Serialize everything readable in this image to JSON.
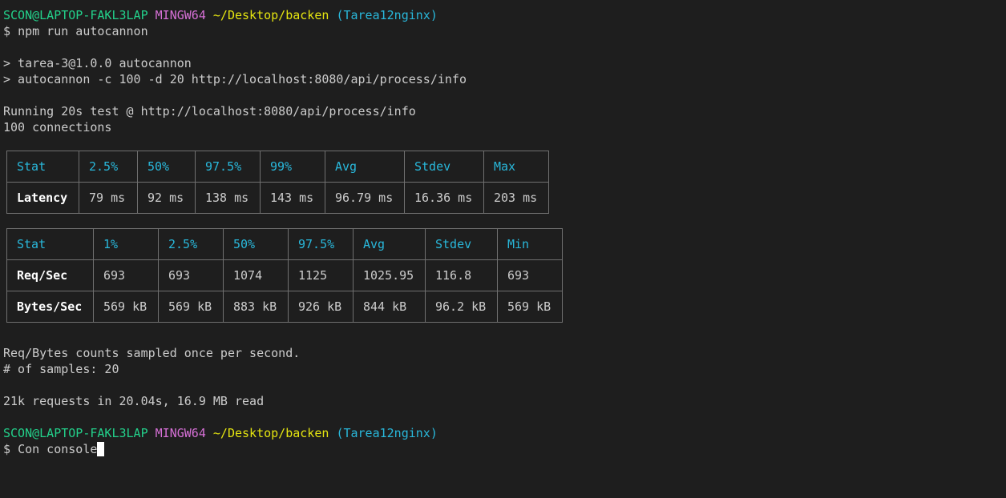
{
  "prompt": {
    "user_host": "SCON@LAPTOP-FAKL3LAP",
    "shell": "MINGW64",
    "path": "~/Desktop/backen",
    "branch": "(Tarea12nginx)",
    "symbol": "$"
  },
  "command": "npm run autocannon",
  "npm_output": [
    "> tarea-3@1.0.0 autocannon",
    "> autocannon -c 100 -d 20 http://localhost:8080/api/process/info"
  ],
  "run_info": [
    "Running 20s test @ http://localhost:8080/api/process/info",
    "100 connections"
  ],
  "latency_table": {
    "headers": [
      "Stat",
      "2.5%",
      "50%",
      "97.5%",
      "99%",
      "Avg",
      "Stdev",
      "Max"
    ],
    "rows": [
      [
        "Latency",
        "79 ms",
        "92 ms",
        "138 ms",
        "143 ms",
        "96.79 ms",
        "16.36 ms",
        "203 ms"
      ]
    ]
  },
  "throughput_table": {
    "headers": [
      "Stat",
      "1%",
      "2.5%",
      "50%",
      "97.5%",
      "Avg",
      "Stdev",
      "Min"
    ],
    "rows": [
      [
        "Req/Sec",
        "693",
        "693",
        "1074",
        "1125",
        "1025.95",
        "116.8",
        "693"
      ],
      [
        "Bytes/Sec",
        "569 kB",
        "569 kB",
        "883 kB",
        "926 kB",
        "844 kB",
        "96.2 kB",
        "569 kB"
      ]
    ]
  },
  "footer": [
    "Req/Bytes counts sampled once per second.",
    "# of samples: 20"
  ],
  "summary": "21k requests in 20.04s, 16.9 MB read",
  "current_input": "Con console",
  "colors": {
    "background": "#1e1e1e",
    "text": "#cccccc",
    "user_host": "#23d18b",
    "shell": "#d670d6",
    "path": "#e5e510",
    "branch": "#29b8db",
    "table_header": "#29b8db",
    "table_border": "#707070"
  }
}
